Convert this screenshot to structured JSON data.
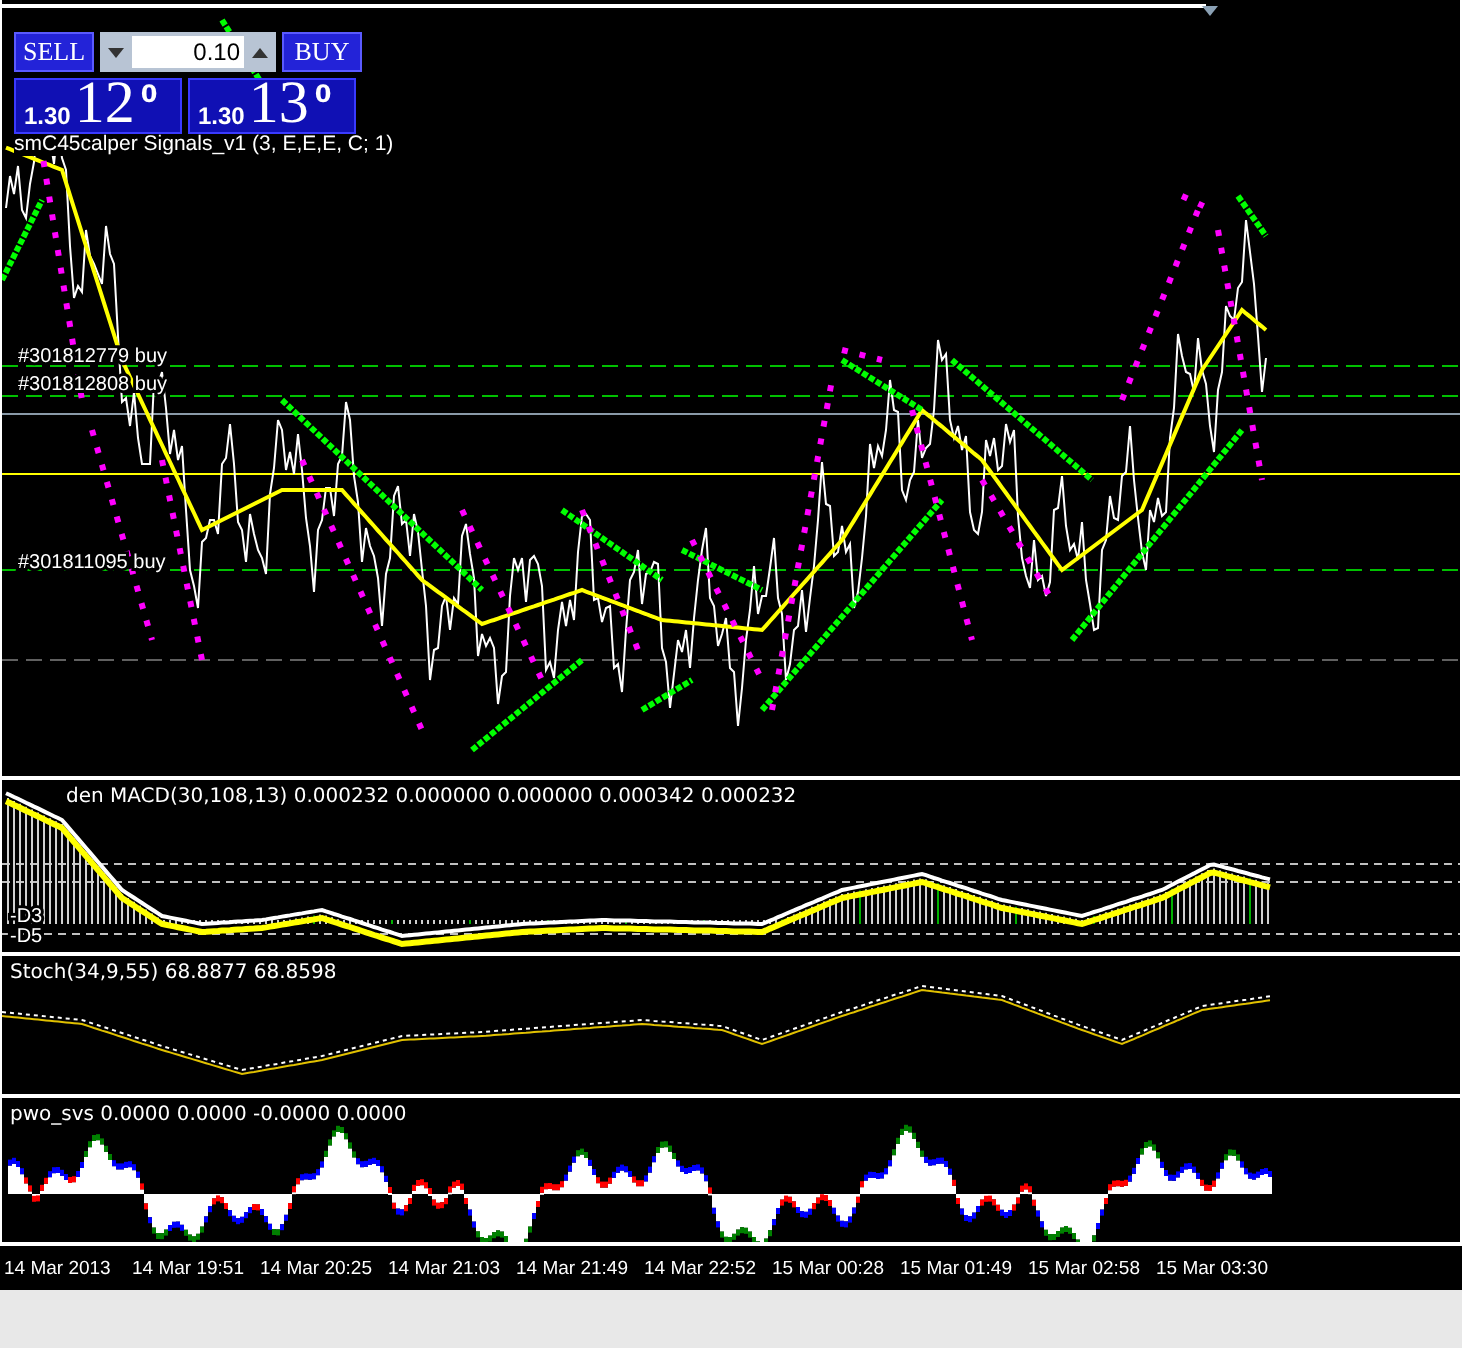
{
  "trade_panel": {
    "sell_label": "SELL",
    "buy_label": "BUY",
    "lot": "0.10",
    "prices": [
      {
        "prefix": "1.30",
        "big": "12",
        "sup": "0"
      },
      {
        "prefix": "1.30",
        "big": "13",
        "sup": "0"
      }
    ]
  },
  "main_chart": {
    "indicator_label": "smC45calper Signals_v1 (3, E,E,E, C; 1)",
    "orders": [
      {
        "label": "#301812779 buy"
      },
      {
        "label": "#301812808 buy"
      },
      {
        "label": "#301811095 buy"
      }
    ]
  },
  "macd_panel": {
    "label": "den MACD(30,108,13) 0.000232 0.000000 0.000000 0.000342 0.000232",
    "levels": [
      "-D3",
      "-D5"
    ]
  },
  "stoch_panel": {
    "label": "Stoch(34,9,55) 68.8877 68.8598"
  },
  "pwo_panel": {
    "label": "pwo_svs 0.0000 0.0000 -0.0000 0.0000"
  },
  "time_axis": {
    "labels": [
      "14 Mar 2013",
      "14 Mar 19:51",
      "14 Mar 20:25",
      "14 Mar 21:03",
      "14 Mar 21:49",
      "14 Mar 22:52",
      "15 Mar 00:28",
      "15 Mar 01:49",
      "15 Mar 02:58",
      "15 Mar 03:30"
    ]
  }
}
